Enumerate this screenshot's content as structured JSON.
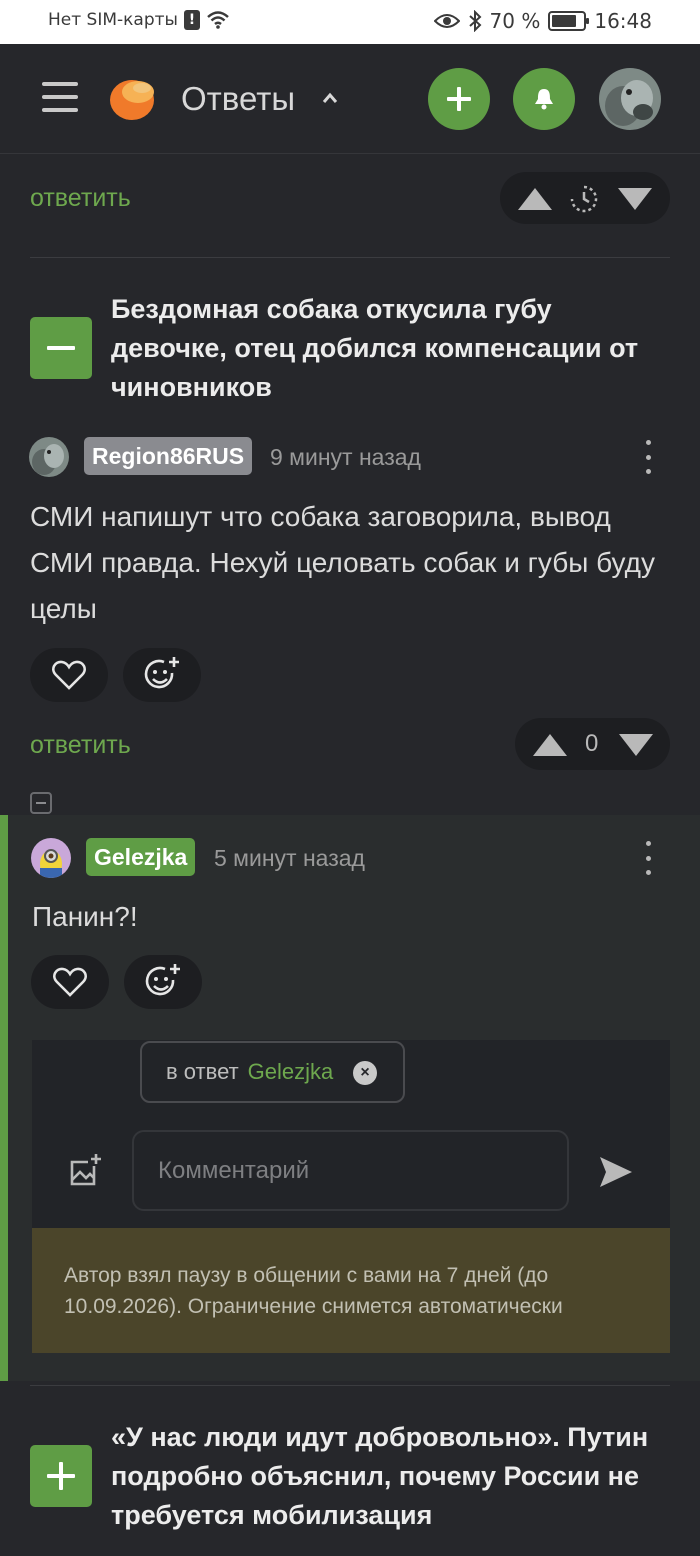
{
  "status_bar": {
    "carrier": "Нет SIM-карты",
    "battery": "70 %",
    "time": "16:48"
  },
  "header": {
    "title": "Ответы",
    "icons": [
      "menu-icon",
      "logo",
      "chevron-up-icon",
      "plus-icon",
      "bell-icon",
      "avatar"
    ]
  },
  "top_reply": {
    "reply_label": "ответить",
    "vote_icons": [
      "arrow-up-icon",
      "clock-icon",
      "arrow-down-icon"
    ]
  },
  "post1": {
    "title": "Бездомная собака откусила губу девочке, отец добился компенсации от чиновников",
    "toggle": "−"
  },
  "comment1": {
    "username": "Region86RUS",
    "time": "9 минут назад",
    "text": "СМИ напишут что собака заговорила, вывод СМИ правда. Нехуй целовать собак и губы буду целы",
    "reply_label": "ответить",
    "score": "0"
  },
  "comment2": {
    "username": "Gelezjka",
    "time": "5 минут назад",
    "text": "Панин?!"
  },
  "reply_form": {
    "reply_to_prefix": "в ответ",
    "reply_to_name": "Gelezjka",
    "placeholder": "Комментарий",
    "notice": "Автор взял паузу в общении с вами на 7 дней (до 10.09.2026). Ограничение снимется автоматически"
  },
  "post2": {
    "title": "«У нас люди идут добровольно». Путин подробно объяснил, почему России не требуется мобилизация",
    "toggle": "+"
  },
  "colors": {
    "accent_green": "#5f9d45",
    "link_green": "#6ea84e",
    "background": "#26272b",
    "notice_bg": "#4b452a"
  }
}
